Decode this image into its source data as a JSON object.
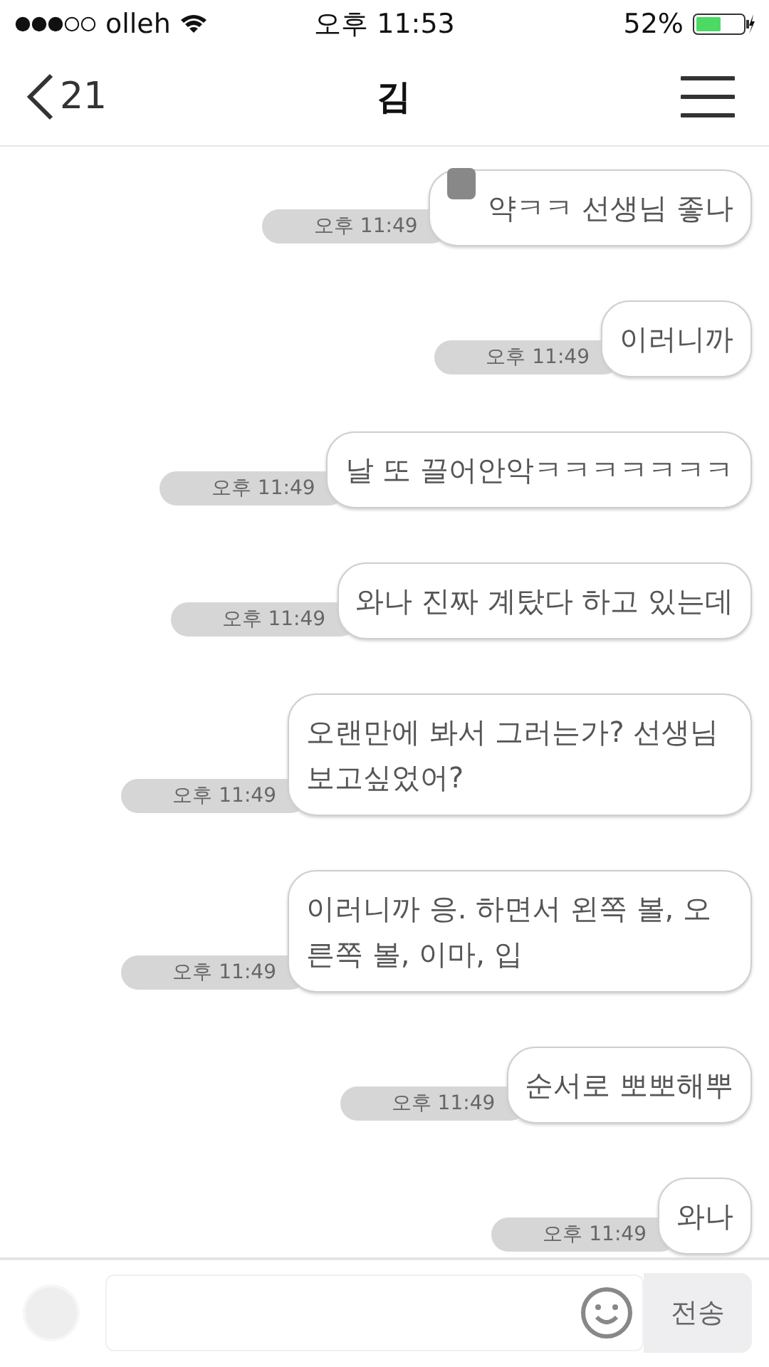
{
  "status_bar": {
    "carrier": "olleh",
    "time": "오후 11:53",
    "battery": "52%"
  },
  "nav": {
    "back_count": "21",
    "title": "김"
  },
  "messages": [
    {
      "time": "오후 11:49",
      "text": "약ㅋㅋ 선생님 좋나",
      "redacted": true
    },
    {
      "time": "오후 11:49",
      "text": "이러니까",
      "redacted": false
    },
    {
      "time": "오후 11:49",
      "text": "날 또 끌어안악ㅋㅋㅋㅋㅋㅋㅋ",
      "redacted": false
    },
    {
      "time": "오후 11:49",
      "text": "와나 진짜 계탔다 하고 있는데",
      "redacted": false
    },
    {
      "time": "오후 11:49",
      "text": "오랜만에 봐서 그러는가? 선생님 보고싶었어?",
      "redacted": false
    },
    {
      "time": "오후 11:49",
      "text": "이러니까 응. 하면서 왼쪽 볼, 오른쪽 볼, 이마, 입",
      "redacted": false
    },
    {
      "time": "오후 11:49",
      "text": "순서로 뽀뽀해뿌",
      "redacted": false
    },
    {
      "time": "오후 11:49",
      "text": "와나",
      "redacted": false
    }
  ],
  "composer": {
    "send_label": "전송"
  }
}
